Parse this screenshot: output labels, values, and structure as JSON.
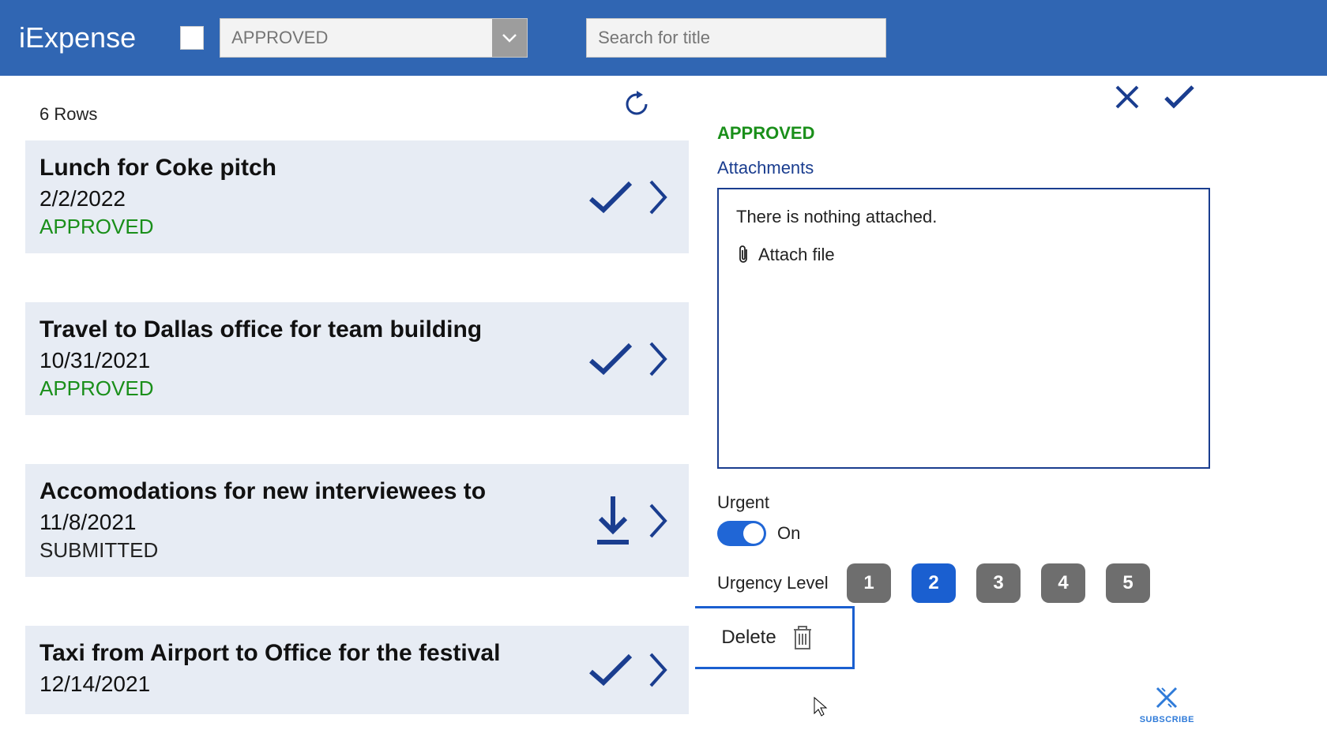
{
  "app": {
    "title": "iExpense"
  },
  "filter": {
    "status_placeholder": "APPROVED",
    "search_placeholder": "Search for title"
  },
  "rows_label": "6 Rows",
  "rows": [
    {
      "title": "Lunch for Coke pitch",
      "date": "2/2/2022",
      "status": "APPROVED",
      "icon": "check"
    },
    {
      "title": "Travel to Dallas office for team building",
      "date": "10/31/2021",
      "status": "APPROVED",
      "icon": "check"
    },
    {
      "title": "Accomodations for new interviewees to",
      "date": "11/8/2021",
      "status": "SUBMITTED",
      "icon": "download"
    },
    {
      "title": "Taxi from Airport to Office for the festival",
      "date": "12/14/2021",
      "status": "",
      "icon": "check"
    }
  ],
  "detail": {
    "status": "APPROVED",
    "attachments_label": "Attachments",
    "attachments_empty": "There is nothing attached.",
    "attach_file_label": "Attach file",
    "urgent_label": "Urgent",
    "urgent_value": "On",
    "urgency_level_label": "Urgency Level",
    "levels": [
      "1",
      "2",
      "3",
      "4",
      "5"
    ],
    "selected_level": "2",
    "delete_label": "Delete"
  },
  "subscribe": "SUBSCRIBE"
}
